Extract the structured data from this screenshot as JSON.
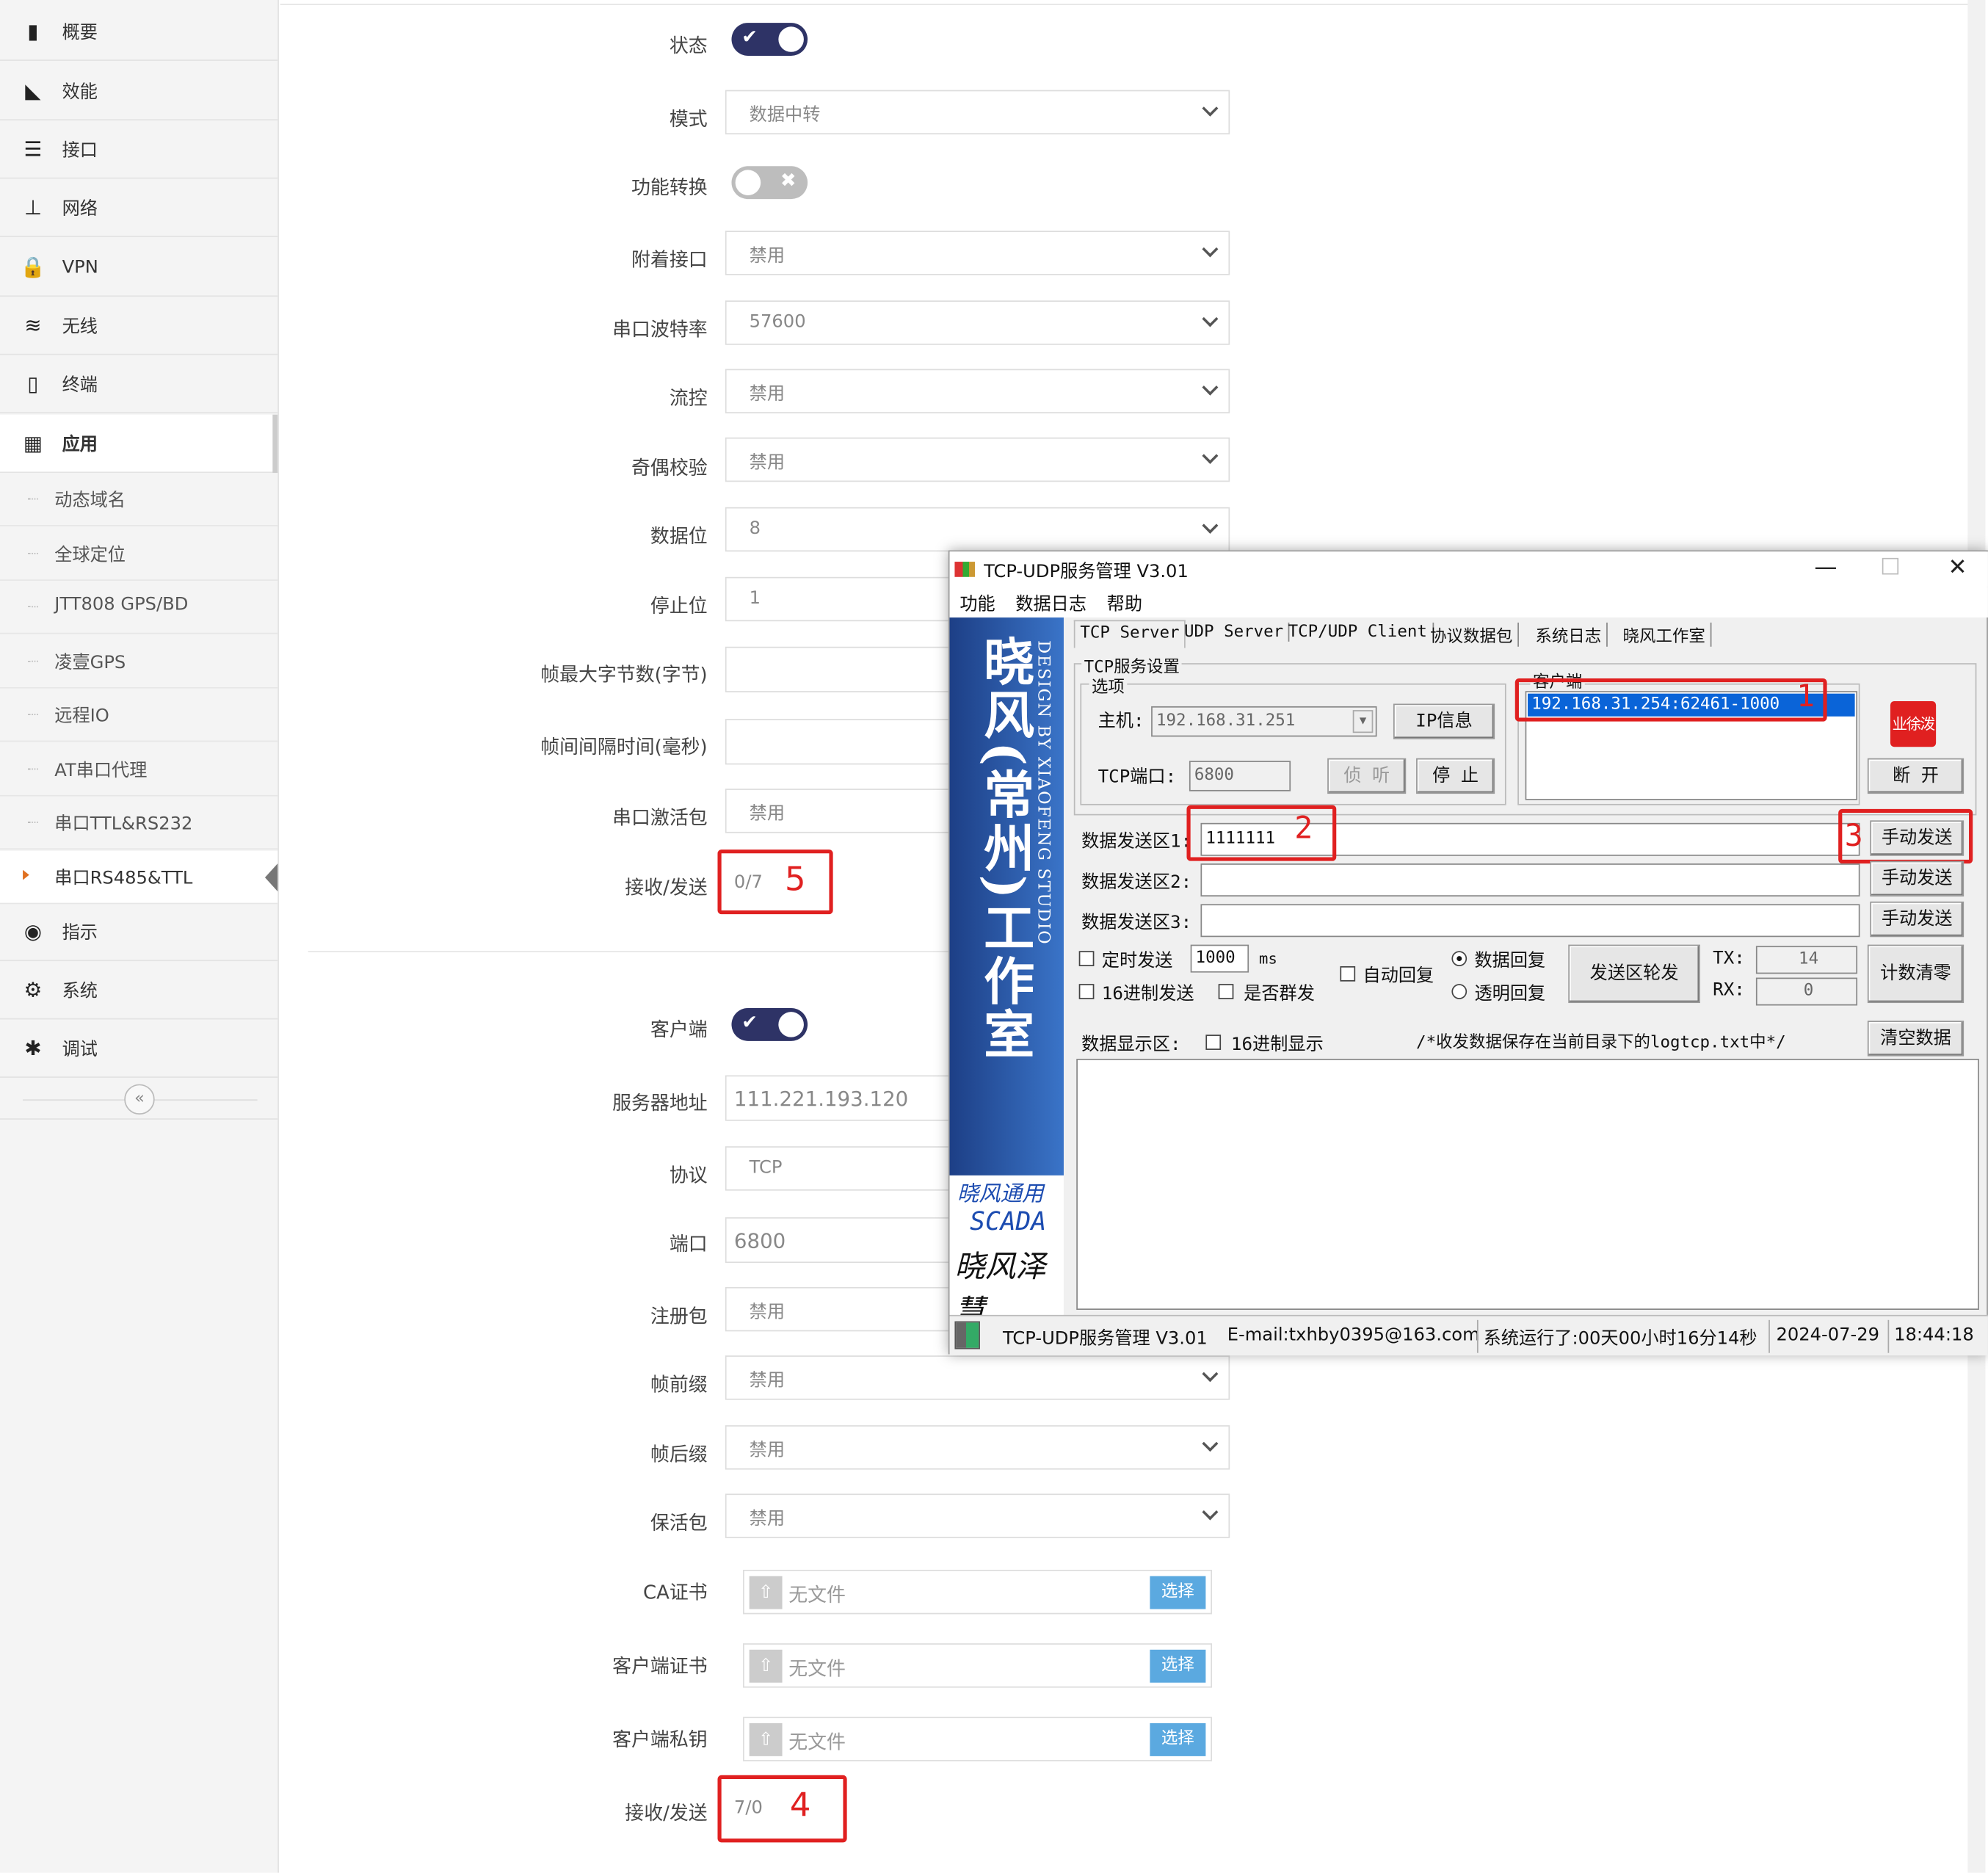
{
  "sidebar": {
    "items": [
      {
        "label": "概要",
        "icon": "bookmark-icon",
        "glyph": "▮"
      },
      {
        "label": "效能",
        "icon": "area-chart-icon",
        "glyph": "◣"
      },
      {
        "label": "接口",
        "icon": "list-icon",
        "glyph": "☰"
      },
      {
        "label": "网络",
        "icon": "sitemap-icon",
        "glyph": "⊥"
      },
      {
        "label": "VPN",
        "icon": "lock-icon",
        "glyph": "🔒"
      },
      {
        "label": "无线",
        "icon": "wifi-icon",
        "glyph": "≋"
      },
      {
        "label": "终端",
        "icon": "mobile-icon",
        "glyph": "▯"
      },
      {
        "label": "应用",
        "icon": "building-icon",
        "glyph": "▦"
      }
    ],
    "submenu": [
      {
        "label": "动态域名"
      },
      {
        "label": "全球定位"
      },
      {
        "label": "JTT808 GPS/BD"
      },
      {
        "label": "凌壹GPS"
      },
      {
        "label": "远程IO"
      },
      {
        "label": "AT串口代理"
      },
      {
        "label": "串口TTL&RS232"
      },
      {
        "label": "串口RS485&TTL"
      }
    ],
    "items_after": [
      {
        "label": "指示",
        "icon": "eye-icon",
        "glyph": "◉"
      },
      {
        "label": "系统",
        "icon": "gears-icon",
        "glyph": "⚙"
      },
      {
        "label": "调试",
        "icon": "bug-icon",
        "glyph": "✱"
      }
    ],
    "collapse_glyph": "«"
  },
  "serial": {
    "status": {
      "label": "状态",
      "value": "on",
      "mark": "✔"
    },
    "mode": {
      "label": "模式",
      "value": "数据中转"
    },
    "func_switch": {
      "label": "功能转换",
      "value": "off",
      "mark": "✖"
    },
    "attach_if": {
      "label": "附着接口",
      "value": "禁用"
    },
    "baud": {
      "label": "串口波特率",
      "value": "57600"
    },
    "flow": {
      "label": "流控",
      "value": "禁用"
    },
    "parity": {
      "label": "奇偶校验",
      "value": "禁用"
    },
    "databits": {
      "label": "数据位",
      "value": "8"
    },
    "stopbits": {
      "label": "停止位",
      "value": "1"
    },
    "max_bytes": {
      "label": "帧最大字节数(字节)",
      "value": ""
    },
    "interval": {
      "label": "帧间间隔时间(毫秒)",
      "value": ""
    },
    "activate": {
      "label": "串口激活包",
      "value": "禁用"
    },
    "rxtx": {
      "label": "接收/发送",
      "value": "0/7",
      "annotation": "5"
    }
  },
  "client": {
    "enabled": {
      "label": "客户端",
      "value": "on",
      "mark": "✔"
    },
    "server": {
      "label": "服务器地址",
      "value": "111.221.193.120"
    },
    "protocol": {
      "label": "协议",
      "value": "TCP"
    },
    "port": {
      "label": "端口",
      "value": "6800"
    },
    "register": {
      "label": "注册包",
      "value": "禁用"
    },
    "prefix": {
      "label": "帧前缀",
      "value": "禁用"
    },
    "suffix": {
      "label": "帧后缀",
      "value": "禁用"
    },
    "keepalive": {
      "label": "保活包",
      "value": "禁用"
    },
    "ca": {
      "label": "CA证书",
      "value": "无文件",
      "button": "选择"
    },
    "cert": {
      "label": "客户端证书",
      "value": "无文件",
      "button": "选择"
    },
    "key": {
      "label": "客户端私钥",
      "value": "无文件",
      "button": "选择"
    },
    "rxtx": {
      "label": "接收/发送",
      "value": "7/0",
      "annotation": "4"
    }
  },
  "tool": {
    "title": "TCP-UDP服务管理 V3.01",
    "win_buttons": {
      "min": "—",
      "max": "☐",
      "close": "✕"
    },
    "menu": [
      "功能",
      "数据日志",
      "帮助"
    ],
    "brand": {
      "cn": "晓风(常州)工作室",
      "en": "DESIGN BY XIAOFENG STUDIO",
      "line1": "晓风通用",
      "line2": "SCADA",
      "line3": "晓风泽慧"
    },
    "tabs": [
      "TCP Server",
      "UDP Server",
      "TCP/UDP Client",
      "协议数据包",
      "系统日志",
      "晓风工作室"
    ],
    "group_label": "TCP服务设置",
    "options_label": "选项",
    "host_label": "主机:",
    "host_value": "192.168.31.251",
    "ipinfo_btn": "IP信息",
    "port_label": "TCP端口:",
    "port_value": "6800",
    "listen_btn": "侦 听",
    "stop_btn": "停 止",
    "clients_label": "客户端",
    "client_entry": "192.168.31.254:62461-1000",
    "disconnect_btn": "断 开",
    "seal_text": "业徐泼",
    "send_rows": [
      {
        "label": "数据发送区1:",
        "value": "1111111",
        "button": "手动发送"
      },
      {
        "label": "数据发送区2:",
        "value": "",
        "button": "手动发送"
      },
      {
        "label": "数据发送区3:",
        "value": "",
        "button": "手动发送"
      }
    ],
    "timed_label": "定时发送",
    "timed_value": "1000",
    "ms_label": "ms",
    "hex_send_label": "16进制发送",
    "auto_reply_label": "自动回复",
    "broadcast_label": "是否群发",
    "data_reply_label": "数据回复",
    "transparent_reply_label": "透明回复",
    "rotate_btn": "发送区轮发",
    "tx_label": "TX:",
    "tx_value": "14",
    "rx_label": "RX:",
    "rx_value": "0",
    "reset_btn": "计数清零",
    "display_label": "数据显示区:",
    "hex_display_label": "16进制显示",
    "log_note": "/*收发数据保存在当前目录下的logtcp.txt中*/",
    "clear_btn": "清空数据",
    "annotations": [
      "1",
      "2",
      "3"
    ],
    "status_bar": {
      "app": "TCP-UDP服务管理 V3.01",
      "email": "E-mail:txhby0395@163.com",
      "uptime": "系统运行了:00天00小时16分14秒",
      "date": "2024-07-29",
      "time": "18:44:18"
    }
  },
  "colors": {
    "toggle_on": "#2e3366",
    "annotation": "#e02020",
    "select_button": "#5ba9e0",
    "brand_blue": "#1d3f86"
  }
}
